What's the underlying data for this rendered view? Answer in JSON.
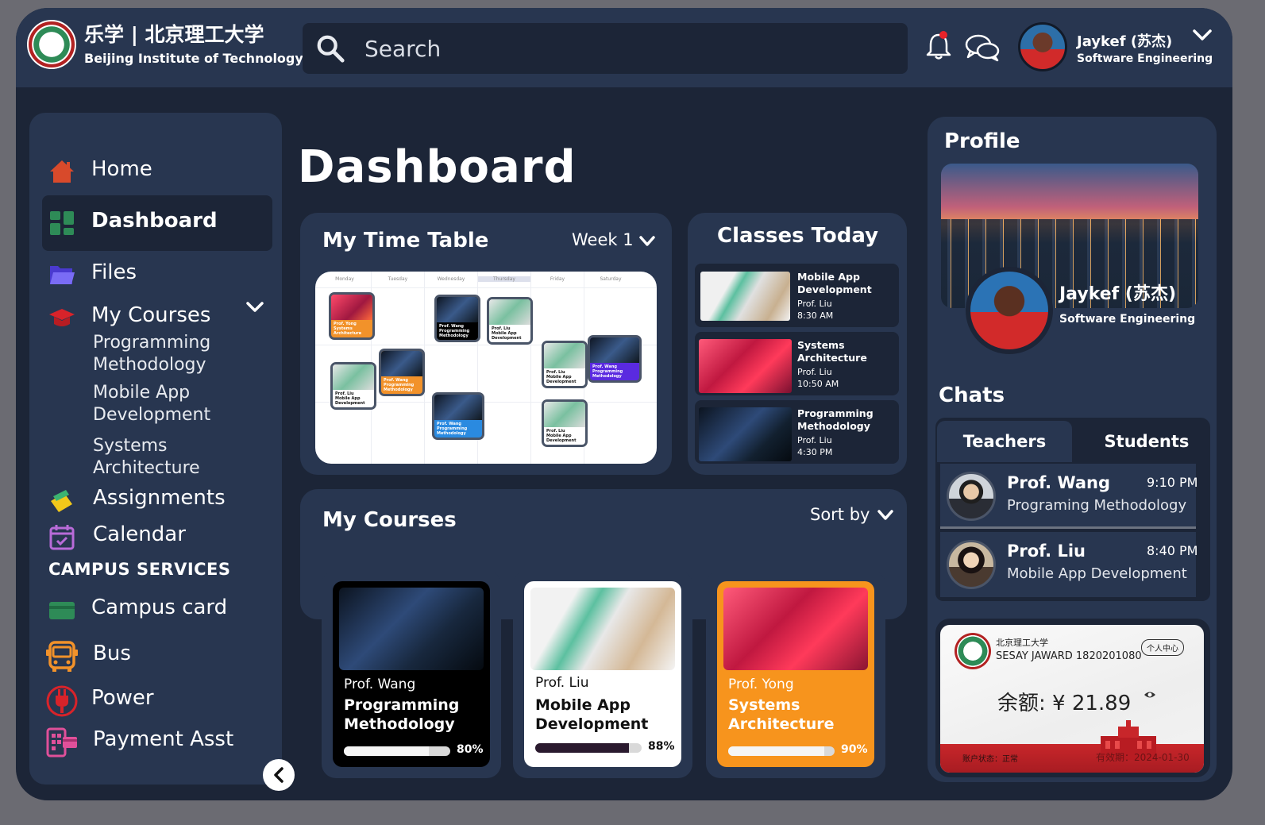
{
  "brand": {
    "title_cn": "乐学 | 北京理工大学",
    "subtitle": "Beijing Institute of Technology"
  },
  "search": {
    "placeholder": "Search"
  },
  "user": {
    "name": "Jaykef (苏杰)",
    "role": "Software Engineering"
  },
  "sidebar": {
    "items": [
      {
        "label": "Home",
        "icon": "home-icon",
        "color": "#d84a2b"
      },
      {
        "label": "Dashboard",
        "icon": "dashboard-icon",
        "color": "#2e8b57",
        "active": true
      },
      {
        "label": "Files",
        "icon": "folder-icon",
        "color": "#6b5cf0"
      },
      {
        "label": "My Courses",
        "icon": "graduation-cap-icon",
        "color": "#d8232a"
      }
    ],
    "courses": [
      "Programming Methodology",
      "Mobile App Development",
      "Systems Architecture"
    ],
    "more_items": [
      {
        "label": "Assignments",
        "icon": "assignments-icon"
      },
      {
        "label": "Calendar",
        "icon": "calendar-icon"
      }
    ],
    "campus_section": "CAMPUS SERVICES",
    "campus_items": [
      {
        "label": "Campus card",
        "icon": "campus-card-icon"
      },
      {
        "label": "Bus",
        "icon": "bus-icon"
      },
      {
        "label": "Power",
        "icon": "power-icon"
      },
      {
        "label": "Payment Asst",
        "icon": "payment-icon"
      }
    ]
  },
  "page_title": "Dashboard",
  "timetable": {
    "title": "My Time Table",
    "week": "Week 1",
    "days": [
      "Monday",
      "Tuesday",
      "Wednesday",
      "Thursday",
      "Friday",
      "Saturday"
    ],
    "cards": [
      {
        "prof": "Prof. Yong",
        "course": "Systems Architecture"
      },
      {
        "prof": "Prof. Wang",
        "course": "Programming Methodology"
      },
      {
        "prof": "Prof. Liu",
        "course": "Mobile App Development"
      },
      {
        "prof": "Prof. Liu",
        "course": "Mobile App Development"
      },
      {
        "prof": "Prof. Wang",
        "course": "Programming Methodology"
      },
      {
        "prof": "Prof. Wang",
        "course": "Programming Methodology"
      },
      {
        "prof": "Prof. Liu",
        "course": "Mobile App Development"
      },
      {
        "prof": "Prof. Wang",
        "course": "Programming Methodology"
      },
      {
        "prof": "Prof. Liu",
        "course": "Mobile App Development"
      }
    ]
  },
  "classes_today": {
    "title": "Classes Today",
    "items": [
      {
        "name": "Mobile App Development",
        "prof": "Prof. Liu",
        "time": "8:30 AM"
      },
      {
        "name": "Systems Architecture",
        "prof": "Prof. Liu",
        "time": "10:50 AM"
      },
      {
        "name": "Programming Methodology",
        "prof": "Prof. Liu",
        "time": "4:30 PM"
      }
    ]
  },
  "my_courses": {
    "title": "My Courses",
    "sort_label": "Sort by",
    "cards": [
      {
        "prof": "Prof. Wang",
        "name": "Programming Methodology",
        "progress": 80,
        "progress_label": "80%"
      },
      {
        "prof": "Prof. Liu",
        "name": "Mobile App Development",
        "progress": 88,
        "progress_label": "88%"
      },
      {
        "prof": "Prof. Yong",
        "name": "Systems Architecture",
        "progress": 90,
        "progress_label": "90%"
      }
    ]
  },
  "profile": {
    "title": "Profile",
    "name": "Jaykef (苏杰)",
    "role": "Software Engineering"
  },
  "chats": {
    "title": "Chats",
    "tabs": [
      "Teachers",
      "Students"
    ],
    "items": [
      {
        "name": "Prof. Wang",
        "time": "9:10  PM",
        "course": "Programing Methodology"
      },
      {
        "name": "Prof.  Liu",
        "time": "8:40  PM",
        "course": "Mobile App Development"
      }
    ]
  },
  "campus_card": {
    "university": "北京理工大学",
    "holder": "SESAY JAWARD 1820201080",
    "center_button": "个人中心",
    "balance": "余额: ¥ 21.89",
    "status": "账户状态：正常",
    "expiry": "有效期：2024-01-30"
  }
}
